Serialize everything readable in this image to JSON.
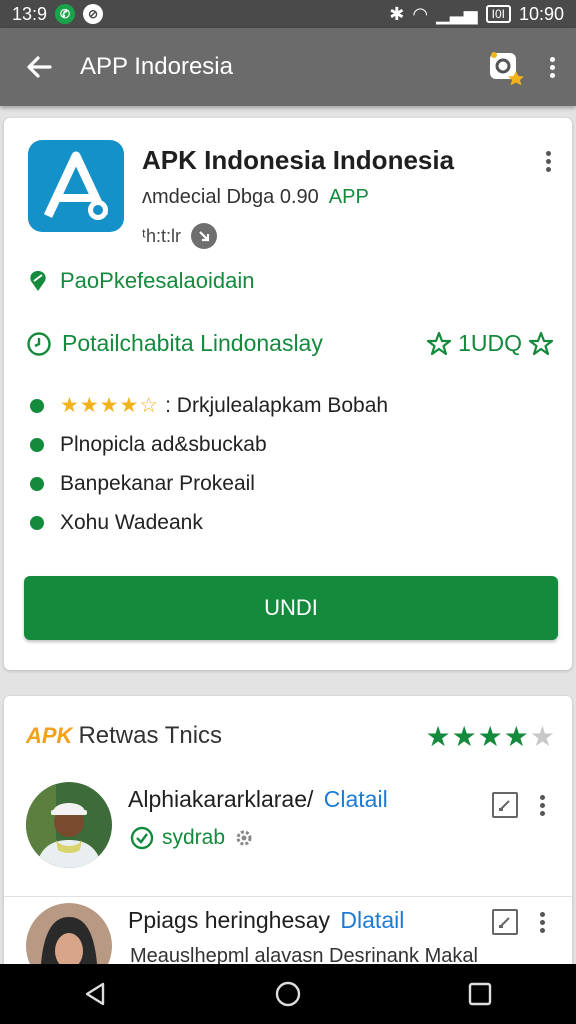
{
  "status": {
    "left_time": "13:9",
    "right_time": "10:90",
    "battery": "I0I"
  },
  "app_bar": {
    "title": "APP Indoresia"
  },
  "app": {
    "name": "APK Indonesia Indonesia",
    "developer": "ᴧmdecial Dbga 0.90",
    "dev_badge": "APP",
    "rating_text": "ᵗh:t:lr"
  },
  "features": {
    "line1": "PaoPkefesalaoidain",
    "line2": "Potailchabita Lindonaslay",
    "score": "1UDQ"
  },
  "bullets": [
    {
      "stars": "★★★★☆",
      "text": ": Drkjulealapkam Bobah"
    },
    {
      "stars": "",
      "text": "Plnopicla ad&sbuckab"
    },
    {
      "stars": "",
      "text": "Banpekanar Prokeail"
    },
    {
      "stars": "",
      "text": "Xohu Wadeank"
    }
  ],
  "install_label": "UNDI",
  "reviews_section": {
    "badge": "APK",
    "title": "Retwas Tnics",
    "rating": 4
  },
  "reviews": [
    {
      "name": "Alphiakararklarae/",
      "detail": "Clatail",
      "tag": "sydrab"
    },
    {
      "name": "Ppiags heringhesay",
      "detail": "Dlatail",
      "text": "Meauslhepml alavasn Desrinank Makal"
    }
  ],
  "colors": {
    "accent": "#148a3c",
    "app_bar": "#6b6b6b",
    "status_bar": "#4a4a4a",
    "star": "#f2b21b",
    "link": "#1b7bd6"
  },
  "icons": [
    "back-arrow-icon",
    "search-badge-icon",
    "more-vert-icon",
    "pin-icon",
    "clock-icon",
    "star-outline-icon",
    "check-circle-icon",
    "edit-icon",
    "gear-icon",
    "nav-back-icon",
    "nav-home-icon",
    "nav-recents-icon"
  ]
}
